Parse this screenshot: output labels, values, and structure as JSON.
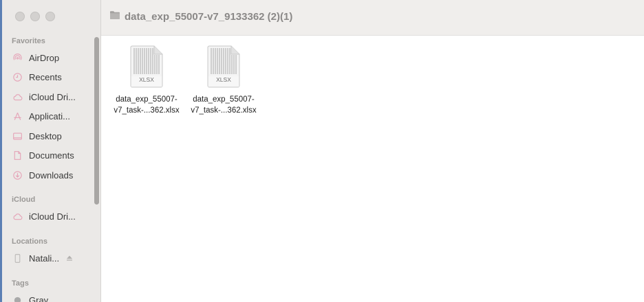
{
  "window": {
    "title": "data_exp_55007-v7_9133362 (2)(1)"
  },
  "sidebar": {
    "favorites_header": "Favorites",
    "favorites": [
      {
        "label": "AirDrop",
        "icon": "airdrop-icon"
      },
      {
        "label": "Recents",
        "icon": "clock-icon"
      },
      {
        "label": "iCloud Dri...",
        "icon": "cloud-icon"
      },
      {
        "label": "Applicati...",
        "icon": "applications-icon"
      },
      {
        "label": "Desktop",
        "icon": "desktop-icon"
      },
      {
        "label": "Documents",
        "icon": "document-icon"
      },
      {
        "label": "Downloads",
        "icon": "download-icon"
      }
    ],
    "icloud_header": "iCloud",
    "icloud": [
      {
        "label": "iCloud Dri...",
        "icon": "cloud-icon"
      }
    ],
    "locations_header": "Locations",
    "locations": [
      {
        "label": "Natali...",
        "icon": "phone-icon"
      }
    ],
    "tags_header": "Tags",
    "tags": [
      {
        "label": "Gray",
        "color": "#a9a9a9"
      }
    ]
  },
  "files": [
    {
      "type_label": "XLSX",
      "name_line1": "data_exp_55007-",
      "name_line2": "v7_task-...362.xlsx"
    },
    {
      "type_label": "XLSX",
      "name_line1": "data_exp_55007-",
      "name_line2": "v7_task-...362.xlsx"
    }
  ],
  "colors": {
    "sidebar_bg": "#ebe9e7",
    "icon_pink": "#e5a3b7",
    "toolbar_bg": "#f0eeec"
  }
}
